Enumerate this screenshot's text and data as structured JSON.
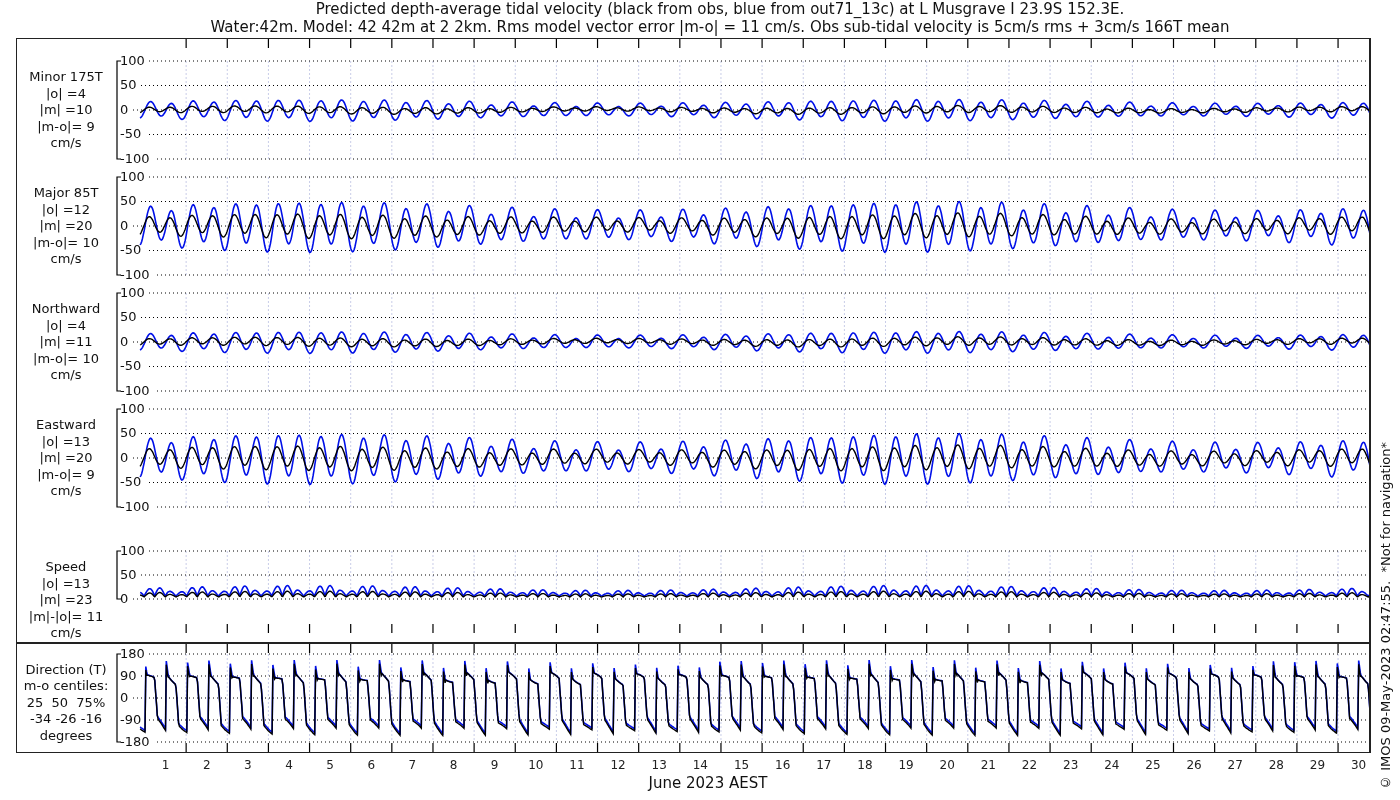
{
  "title_lines": [
    "Predicted depth-average tidal velocity (black from obs, blue from out71_13c) at L Musgrave I 23.9S 152.3E.",
    "Water:42m. Model: 42 42m at 2 2km. Rms model vector error |m-o| = 11 cm/s. Obs sub-tidal velocity is 5cm/s rms + 3cm/s 166T mean"
  ],
  "panels": [
    {
      "kind": "velocity",
      "label_lines": [
        "Minor 175T",
        "|o| =4",
        "|m| =10",
        "|m-o|= 9",
        "cm/s"
      ],
      "yticks": [
        "100",
        "50",
        "0",
        "-50",
        "-100"
      ]
    },
    {
      "kind": "velocity",
      "label_lines": [
        "Major 85T",
        "|o| =12",
        "|m| =20",
        "|m-o|= 10",
        "cm/s"
      ],
      "yticks": [
        "100",
        "50",
        "0",
        "-50",
        "-100"
      ]
    },
    {
      "kind": "velocity",
      "label_lines": [
        "Northward",
        "|o| =4",
        "|m| =11",
        "|m-o|= 10",
        "cm/s"
      ],
      "yticks": [
        "100",
        "50",
        "0",
        "-50",
        "-100"
      ]
    },
    {
      "kind": "velocity",
      "label_lines": [
        "Eastward",
        "|o| =13",
        "|m| =20",
        "|m-o|= 9",
        "cm/s"
      ],
      "yticks": [
        "100",
        "50",
        "0",
        "-50",
        "-100"
      ]
    },
    {
      "kind": "speed",
      "label_lines": [
        "Speed",
        "|o| =13",
        "|m| =23",
        "|m|-|o|= 11",
        "cm/s"
      ],
      "yticks": [
        "100",
        "50",
        "0"
      ]
    },
    {
      "kind": "direction",
      "label_lines": [
        "Direction (T)",
        "m-o centiles:",
        "25  50  75%",
        "-34 -26 -16",
        "degrees"
      ],
      "yticks": [
        "180",
        "90",
        "0",
        "-90",
        "-180"
      ]
    }
  ],
  "x_axis": {
    "ticks": [
      "1",
      "2",
      "3",
      "4",
      "5",
      "6",
      "7",
      "8",
      "9",
      "10",
      "11",
      "12",
      "13",
      "14",
      "15",
      "16",
      "17",
      "18",
      "19",
      "20",
      "21",
      "22",
      "23",
      "24",
      "25",
      "26",
      "27",
      "28",
      "29",
      "30"
    ],
    "label": "June 2023 AEST"
  },
  "footer_note": "© IMOS 09-May-2023 02:47:55.  *Not for navigation*"
}
